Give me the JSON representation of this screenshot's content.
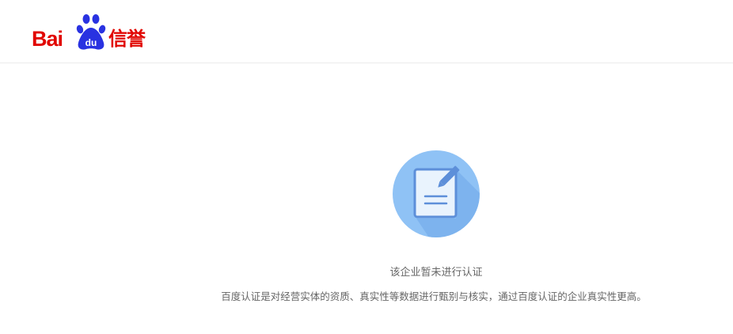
{
  "header": {
    "logo": {
      "text_latin": "Bai",
      "text_paw": "du",
      "text_chinese": "信誉",
      "brand_red": "#e10601",
      "paw_blue": "#2932e1"
    }
  },
  "main": {
    "icon": "document-edit-icon",
    "icon_circle_color": "#8fc2f5",
    "title": "该企业暂未进行认证",
    "description": "百度认证是对经营实体的资质、真实性等数据进行甄别与核实，通过百度认证的企业真实性更高。"
  }
}
